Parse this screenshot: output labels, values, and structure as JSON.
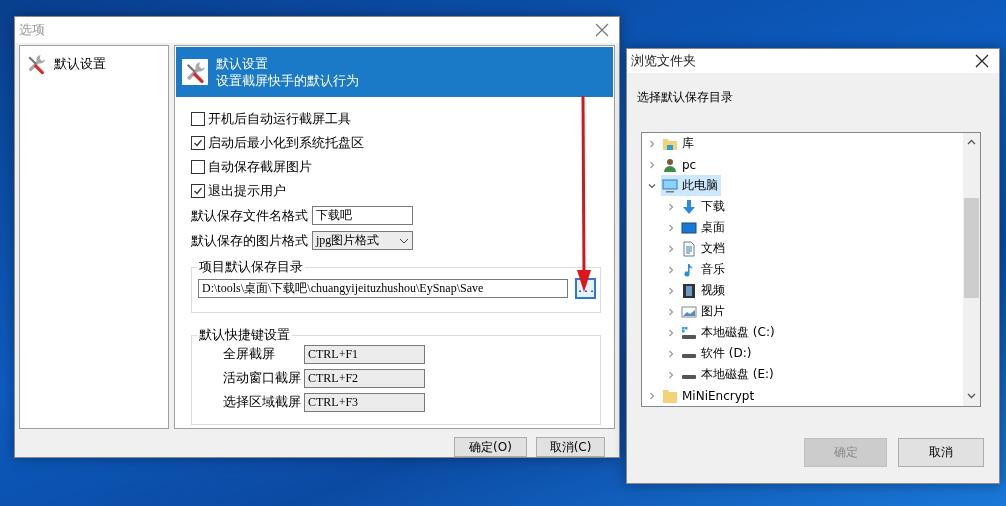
{
  "options_dialog": {
    "title": "选项",
    "nav": [
      {
        "label": "默认设置"
      }
    ],
    "header": {
      "title": "默认设置",
      "subtitle": "设置截屏快手的默认行为"
    },
    "checkboxes": [
      {
        "label": "开机后自动运行截屏工具",
        "checked": false
      },
      {
        "label": "启动后最小化到系统托盘区",
        "checked": true
      },
      {
        "label": "自动保存截屏图片",
        "checked": false
      },
      {
        "label": "退出提示用户",
        "checked": true
      }
    ],
    "fields": [
      {
        "label": "默认保存文件名格式",
        "value": "下载吧",
        "kind": "text"
      },
      {
        "label": "默认保存的图片格式",
        "value": "jpg图片格式",
        "kind": "select"
      }
    ],
    "save_dir": {
      "legend": "项目默认保存目录",
      "value": "D:\\tools\\桌面\\下载吧\\chuangyijeituzhushou\\EySnap\\Save",
      "browse": "..."
    },
    "hotkeys": {
      "legend": "默认快捷键设置",
      "items": [
        {
          "label": "全屏截屏",
          "value": "CTRL+F1"
        },
        {
          "label": "活动窗口截屏",
          "value": "CTRL+F2"
        },
        {
          "label": "选择区域截屏",
          "value": "CTRL+F3"
        }
      ]
    },
    "buttons": [
      "确定(O)",
      "取消(C)"
    ]
  },
  "browse_dialog": {
    "title": "浏览文件夹",
    "prompt": "选择默认保存目录",
    "tree": [
      {
        "label": "库",
        "kind": "library",
        "expanded": false,
        "selected": false
      },
      {
        "label": "pc",
        "kind": "user",
        "expanded": false,
        "selected": false
      },
      {
        "label": "此电脑",
        "kind": "computer",
        "expanded": true,
        "selected": true,
        "children": [
          {
            "label": "下载",
            "kind": "download",
            "expanded": false,
            "selected": false
          },
          {
            "label": "桌面",
            "kind": "desktop",
            "expanded": false,
            "selected": false
          },
          {
            "label": "文档",
            "kind": "documents",
            "expanded": false,
            "selected": false
          },
          {
            "label": "音乐",
            "kind": "music",
            "expanded": false,
            "selected": false
          },
          {
            "label": "视频",
            "kind": "video",
            "expanded": false,
            "selected": false
          },
          {
            "label": "图片",
            "kind": "pictures",
            "expanded": false,
            "selected": false
          },
          {
            "label": "本地磁盘 (C:)",
            "kind": "system_drive",
            "expanded": false,
            "selected": false
          },
          {
            "label": "软件 (D:)",
            "kind": "drive",
            "expanded": false,
            "selected": false
          },
          {
            "label": "本地磁盘 (E:)",
            "kind": "drive",
            "expanded": false,
            "selected": false
          }
        ]
      },
      {
        "label": "MiNiEncrypt",
        "kind": "folder",
        "expanded": false,
        "selected": false
      }
    ],
    "buttons": [
      {
        "label": "确定",
        "disabled": true
      },
      {
        "label": "取消",
        "disabled": false
      }
    ]
  }
}
